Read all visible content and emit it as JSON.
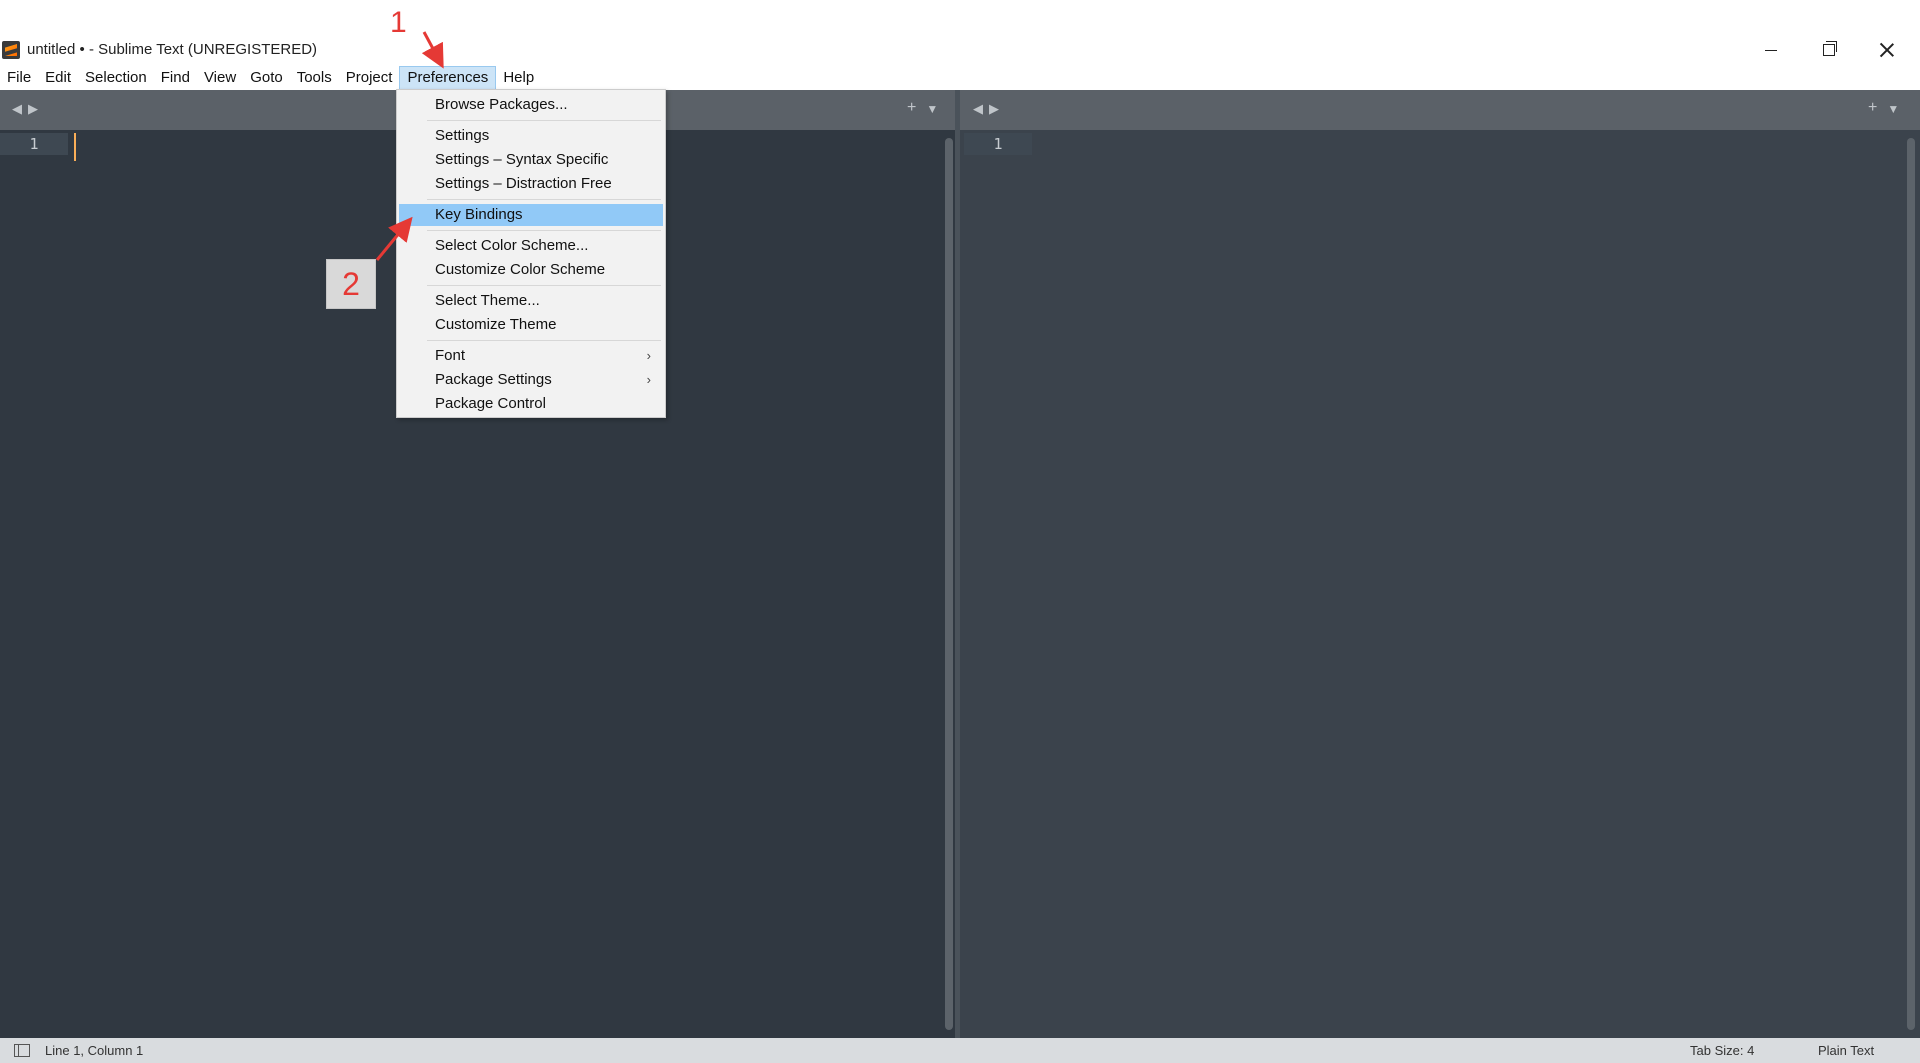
{
  "window": {
    "title": "untitled • - Sublime Text (UNREGISTERED)"
  },
  "menubar": {
    "items": [
      "File",
      "Edit",
      "Selection",
      "Find",
      "View",
      "Goto",
      "Tools",
      "Project",
      "Preferences",
      "Help"
    ],
    "active": "Preferences"
  },
  "dropdown": {
    "items": [
      {
        "label": "Browse Packages..."
      },
      {
        "label": "Settings"
      },
      {
        "label": "Settings – Syntax Specific"
      },
      {
        "label": "Settings – Distraction Free"
      },
      {
        "label": "Key Bindings",
        "highlighted": true
      },
      {
        "label": "Select Color Scheme..."
      },
      {
        "label": "Customize Color Scheme"
      },
      {
        "label": "Select Theme..."
      },
      {
        "label": "Customize Theme"
      },
      {
        "label": "Font",
        "submenu": true
      },
      {
        "label": "Package Settings",
        "submenu": true
      },
      {
        "label": "Package Control"
      }
    ]
  },
  "editor": {
    "left_line_number": "1",
    "right_line_number": "1"
  },
  "statusbar": {
    "position": "Line 1, Column 1",
    "tab_size": "Tab Size: 4",
    "syntax": "Plain Text"
  },
  "annotations": {
    "step1": "1",
    "step2": "2"
  },
  "icons": {
    "tab_nav": [
      "◀",
      "▶"
    ],
    "tab_tools": [
      "+",
      "▼"
    ],
    "submenu_arrow": "›"
  },
  "colors": {
    "editor_bg_left": "#303841",
    "editor_bg_right": "#3b434c",
    "highlight": "#91c9f7",
    "annotation": "#e53935",
    "cursor": "#f9ae58"
  }
}
